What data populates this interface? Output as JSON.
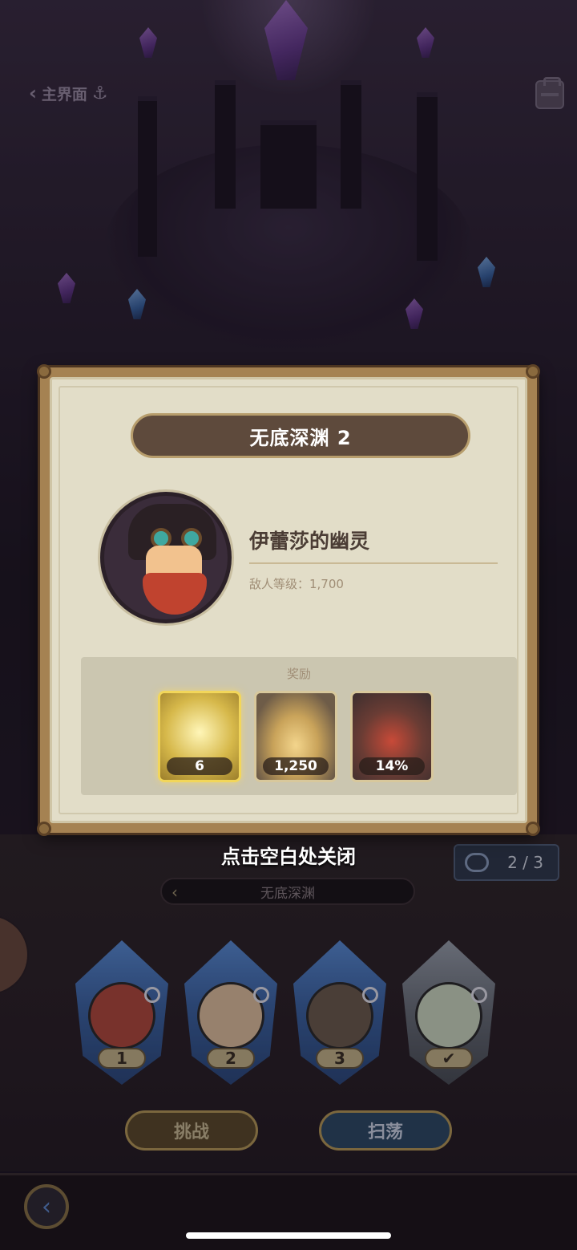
{
  "nav": {
    "back_label": "主界面",
    "anchor_icon": "anchor-icon",
    "chest_icon": "chest-icon"
  },
  "modal": {
    "title": "无底深渊 2",
    "enemy_name": "伊蕾莎的幽灵",
    "enemy_level": "敌人等级：1,700",
    "rewards_label": "奖励",
    "rewards": [
      {
        "icon": "hero-shard-icon",
        "count": "6"
      },
      {
        "icon": "gold-dust-icon",
        "count": "1,250"
      },
      {
        "icon": "boss-portrait-icon",
        "count": "14%"
      }
    ]
  },
  "close_hint": "点击空白处关闭",
  "attempts": "2 / 3",
  "stage_name": "无底深渊",
  "slots": [
    {
      "label": "1"
    },
    {
      "label": "2"
    },
    {
      "label": "3"
    },
    {
      "label": "✔"
    }
  ],
  "buttons": {
    "challenge": "挑战",
    "sweep": "扫荡"
  },
  "colors": {
    "modal_frame": "#a58252",
    "modal_bg": "#e2ddc8",
    "banner": "#5e4a3c",
    "gem_blue": "#3d66a6"
  }
}
